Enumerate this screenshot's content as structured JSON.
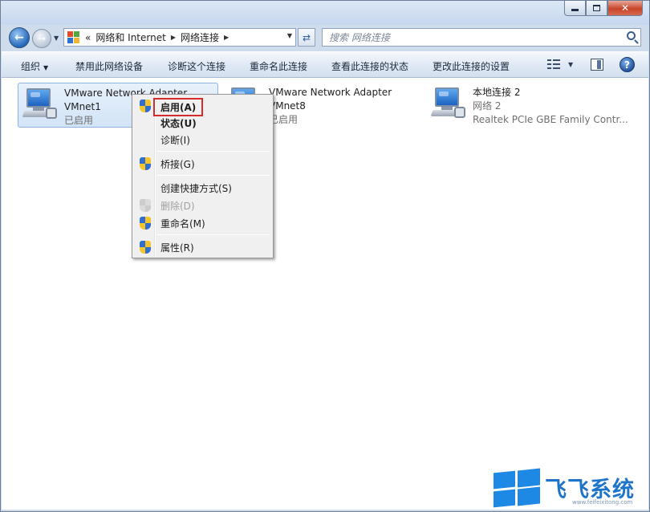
{
  "titlebar": {
    "minimize": "",
    "maximize": "",
    "close": "✕"
  },
  "address": {
    "overflow": "«",
    "crumbs": [
      "网络和 Internet",
      "网络连接"
    ]
  },
  "search": {
    "placeholder": "搜索 网络连接"
  },
  "commands": {
    "organize": "组织",
    "disable": "禁用此网络设备",
    "diagnose": "诊断这个连接",
    "rename": "重命名此连接",
    "status": "查看此连接的状态",
    "settings": "更改此连接的设置"
  },
  "help": "?",
  "adapters": [
    {
      "name": "VMware Network Adapter",
      "sub": "VMnet1",
      "state": "已启用"
    },
    {
      "name": "VMware Network Adapter",
      "sub": "VMnet8",
      "state": "已启用"
    },
    {
      "name": "本地连接 2",
      "sub": "网络  2",
      "state": "Realtek PCIe GBE Family Contr..."
    }
  ],
  "context_menu": {
    "items": [
      {
        "label": "启用(A)"
      },
      {
        "label": "状态(U)"
      },
      {
        "label": "诊断(I)"
      },
      {
        "label": "桥接(G)"
      },
      {
        "label": "创建快捷方式(S)"
      },
      {
        "label": "删除(D)"
      },
      {
        "label": "重命名(M)"
      },
      {
        "label": "属性(R)"
      }
    ]
  },
  "watermark": {
    "brand": "飞飞系统",
    "url": "www.feifeixitong.com"
  },
  "colors": {
    "accent": "#1e74c9",
    "highlight_box": "#d62b2b",
    "command_bar": "#dce7f4"
  }
}
